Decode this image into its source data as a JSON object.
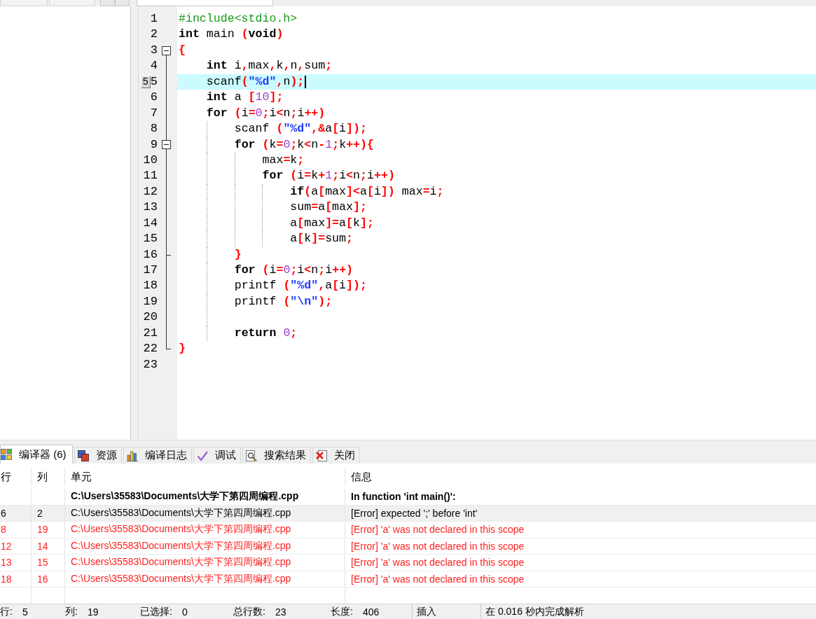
{
  "editor": {
    "lines": [
      {
        "number": "1",
        "tokens": [
          {
            "kind": "preprocessor",
            "text": "#include<stdio.h>"
          }
        ]
      },
      {
        "number": "2",
        "tokens": [
          {
            "kind": "keyword",
            "text": "int"
          },
          {
            "kind": "identifier",
            "text": " main "
          },
          {
            "kind": "symbol",
            "text": "("
          },
          {
            "kind": "keyword",
            "text": "void"
          },
          {
            "kind": "symbol",
            "text": ")"
          }
        ]
      },
      {
        "number": "3",
        "fold": {
          "kind": "start",
          "expanded": true
        },
        "tokens": [
          {
            "kind": "symbol",
            "text": "{"
          }
        ]
      },
      {
        "number": "4",
        "tokens": [
          {
            "kind": "keyword",
            "text": "    int"
          },
          {
            "kind": "identifier",
            "text": " i"
          },
          {
            "kind": "symbol",
            "text": ","
          },
          {
            "kind": "identifier",
            "text": "max"
          },
          {
            "kind": "symbol",
            "text": ","
          },
          {
            "kind": "identifier",
            "text": "k"
          },
          {
            "kind": "symbol",
            "text": ","
          },
          {
            "kind": "identifier",
            "text": "n"
          },
          {
            "kind": "symbol",
            "text": ","
          },
          {
            "kind": "identifier",
            "text": "sum"
          },
          {
            "kind": "symbol",
            "text": ";"
          }
        ]
      },
      {
        "number": "5",
        "marker": "5",
        "current": true,
        "tokens": [
          {
            "kind": "identifier",
            "text": "    scanf"
          },
          {
            "kind": "symbol",
            "text": "("
          },
          {
            "kind": "string",
            "text": "\"%d\""
          },
          {
            "kind": "symbol",
            "text": ","
          },
          {
            "kind": "identifier",
            "text": "n"
          },
          {
            "kind": "symbol",
            "text": ");"
          }
        ]
      },
      {
        "number": "6",
        "tokens": [
          {
            "kind": "keyword",
            "text": "    int"
          },
          {
            "kind": "identifier",
            "text": " a "
          },
          {
            "kind": "symbol",
            "text": "["
          },
          {
            "kind": "number",
            "text": "10"
          },
          {
            "kind": "symbol",
            "text": "];"
          }
        ]
      },
      {
        "number": "7",
        "tokens": [
          {
            "kind": "keyword",
            "text": "    for "
          },
          {
            "kind": "symbol",
            "text": "("
          },
          {
            "kind": "identifier",
            "text": "i"
          },
          {
            "kind": "symbol",
            "text": "="
          },
          {
            "kind": "number",
            "text": "0"
          },
          {
            "kind": "symbol",
            "text": ";"
          },
          {
            "kind": "identifier",
            "text": "i"
          },
          {
            "kind": "symbol",
            "text": "<"
          },
          {
            "kind": "identifier",
            "text": "n"
          },
          {
            "kind": "symbol",
            "text": ";"
          },
          {
            "kind": "identifier",
            "text": "i"
          },
          {
            "kind": "symbol",
            "text": "++)"
          }
        ]
      },
      {
        "number": "8",
        "tokens": [
          {
            "kind": "identifier",
            "text": "        scanf "
          },
          {
            "kind": "symbol",
            "text": "("
          },
          {
            "kind": "string",
            "text": "\"%d\""
          },
          {
            "kind": "symbol",
            "text": ",&"
          },
          {
            "kind": "identifier",
            "text": "a"
          },
          {
            "kind": "symbol",
            "text": "["
          },
          {
            "kind": "identifier",
            "text": "i"
          },
          {
            "kind": "symbol",
            "text": "]);"
          }
        ]
      },
      {
        "number": "9",
        "fold": {
          "kind": "start",
          "expanded": true
        },
        "tokens": [
          {
            "kind": "keyword",
            "text": "        for "
          },
          {
            "kind": "symbol",
            "text": "("
          },
          {
            "kind": "identifier",
            "text": "k"
          },
          {
            "kind": "symbol",
            "text": "="
          },
          {
            "kind": "number",
            "text": "0"
          },
          {
            "kind": "symbol",
            "text": ";"
          },
          {
            "kind": "identifier",
            "text": "k"
          },
          {
            "kind": "symbol",
            "text": "<"
          },
          {
            "kind": "identifier",
            "text": "n"
          },
          {
            "kind": "symbol",
            "text": "-"
          },
          {
            "kind": "number",
            "text": "1"
          },
          {
            "kind": "symbol",
            "text": ";"
          },
          {
            "kind": "identifier",
            "text": "k"
          },
          {
            "kind": "symbol",
            "text": "++){"
          }
        ]
      },
      {
        "number": "10",
        "tokens": [
          {
            "kind": "identifier",
            "text": "            max"
          },
          {
            "kind": "symbol",
            "text": "="
          },
          {
            "kind": "identifier",
            "text": "k"
          },
          {
            "kind": "symbol",
            "text": ";"
          }
        ]
      },
      {
        "number": "11",
        "tokens": [
          {
            "kind": "keyword",
            "text": "            for "
          },
          {
            "kind": "symbol",
            "text": "("
          },
          {
            "kind": "identifier",
            "text": "i"
          },
          {
            "kind": "symbol",
            "text": "="
          },
          {
            "kind": "identifier",
            "text": "k"
          },
          {
            "kind": "symbol",
            "text": "+"
          },
          {
            "kind": "number",
            "text": "1"
          },
          {
            "kind": "symbol",
            "text": ";"
          },
          {
            "kind": "identifier",
            "text": "i"
          },
          {
            "kind": "symbol",
            "text": "<"
          },
          {
            "kind": "identifier",
            "text": "n"
          },
          {
            "kind": "symbol",
            "text": ";"
          },
          {
            "kind": "identifier",
            "text": "i"
          },
          {
            "kind": "symbol",
            "text": "++)"
          }
        ]
      },
      {
        "number": "12",
        "tokens": [
          {
            "kind": "keyword",
            "text": "                if"
          },
          {
            "kind": "symbol",
            "text": "("
          },
          {
            "kind": "identifier",
            "text": "a"
          },
          {
            "kind": "symbol",
            "text": "["
          },
          {
            "kind": "identifier",
            "text": "max"
          },
          {
            "kind": "symbol",
            "text": "]<"
          },
          {
            "kind": "identifier",
            "text": "a"
          },
          {
            "kind": "symbol",
            "text": "["
          },
          {
            "kind": "identifier",
            "text": "i"
          },
          {
            "kind": "symbol",
            "text": "])"
          },
          {
            "kind": "identifier",
            "text": " max"
          },
          {
            "kind": "symbol",
            "text": "="
          },
          {
            "kind": "identifier",
            "text": "i"
          },
          {
            "kind": "symbol",
            "text": ";"
          }
        ]
      },
      {
        "number": "13",
        "tokens": [
          {
            "kind": "identifier",
            "text": "                sum"
          },
          {
            "kind": "symbol",
            "text": "="
          },
          {
            "kind": "identifier",
            "text": "a"
          },
          {
            "kind": "symbol",
            "text": "["
          },
          {
            "kind": "identifier",
            "text": "max"
          },
          {
            "kind": "symbol",
            "text": "];"
          }
        ]
      },
      {
        "number": "14",
        "tokens": [
          {
            "kind": "identifier",
            "text": "                a"
          },
          {
            "kind": "symbol",
            "text": "["
          },
          {
            "kind": "identifier",
            "text": "max"
          },
          {
            "kind": "symbol",
            "text": "]="
          },
          {
            "kind": "identifier",
            "text": "a"
          },
          {
            "kind": "symbol",
            "text": "["
          },
          {
            "kind": "identifier",
            "text": "k"
          },
          {
            "kind": "symbol",
            "text": "];"
          }
        ]
      },
      {
        "number": "15",
        "tokens": [
          {
            "kind": "identifier",
            "text": "                a"
          },
          {
            "kind": "symbol",
            "text": "["
          },
          {
            "kind": "identifier",
            "text": "k"
          },
          {
            "kind": "symbol",
            "text": "]="
          },
          {
            "kind": "identifier",
            "text": "sum"
          },
          {
            "kind": "symbol",
            "text": ";"
          }
        ]
      },
      {
        "number": "16",
        "fold": {
          "kind": "end"
        },
        "tokens": [
          {
            "kind": "symbol",
            "text": "        }"
          }
        ]
      },
      {
        "number": "17",
        "tokens": [
          {
            "kind": "keyword",
            "text": "        for "
          },
          {
            "kind": "symbol",
            "text": "("
          },
          {
            "kind": "identifier",
            "text": "i"
          },
          {
            "kind": "symbol",
            "text": "="
          },
          {
            "kind": "number",
            "text": "0"
          },
          {
            "kind": "symbol",
            "text": ";"
          },
          {
            "kind": "identifier",
            "text": "i"
          },
          {
            "kind": "symbol",
            "text": "<"
          },
          {
            "kind": "identifier",
            "text": "n"
          },
          {
            "kind": "symbol",
            "text": ";"
          },
          {
            "kind": "identifier",
            "text": "i"
          },
          {
            "kind": "symbol",
            "text": "++)"
          }
        ]
      },
      {
        "number": "18",
        "tokens": [
          {
            "kind": "identifier",
            "text": "        printf "
          },
          {
            "kind": "symbol",
            "text": "("
          },
          {
            "kind": "string",
            "text": "\"%d\""
          },
          {
            "kind": "symbol",
            "text": ","
          },
          {
            "kind": "identifier",
            "text": "a"
          },
          {
            "kind": "symbol",
            "text": "["
          },
          {
            "kind": "identifier",
            "text": "i"
          },
          {
            "kind": "symbol",
            "text": "]);"
          }
        ]
      },
      {
        "number": "19",
        "tokens": [
          {
            "kind": "identifier",
            "text": "        printf "
          },
          {
            "kind": "symbol",
            "text": "("
          },
          {
            "kind": "string",
            "text": "\"\\n\""
          },
          {
            "kind": "symbol",
            "text": ");"
          }
        ]
      },
      {
        "number": "20"
      },
      {
        "number": "21",
        "tokens": [
          {
            "kind": "keyword",
            "text": "        return "
          },
          {
            "kind": "number",
            "text": "0"
          },
          {
            "kind": "symbol",
            "text": ";"
          }
        ]
      },
      {
        "number": "22",
        "fold": {
          "kind": "end"
        },
        "tokens": [
          {
            "kind": "symbol",
            "text": "}"
          }
        ]
      },
      {
        "number": "23"
      }
    ]
  },
  "output_tabs": [
    {
      "kind": "compiler",
      "label": "编译器 (6)",
      "selected": true
    },
    {
      "kind": "resources",
      "label": "资源",
      "selected": false
    },
    {
      "kind": "compile_log",
      "label": "编译日志",
      "selected": false
    },
    {
      "kind": "debug",
      "label": "调试",
      "selected": false
    },
    {
      "kind": "search_results",
      "label": "搜索结果",
      "selected": false
    },
    {
      "kind": "close",
      "label": "关闭",
      "selected": false
    }
  ],
  "messages": {
    "columns": [
      "行",
      "列",
      "单元",
      "信息"
    ],
    "rows": [
      {
        "kind": "note",
        "unit": "C:\\Users\\35583\\Documents\\大学下第四周编程.cpp",
        "message": "In function 'int main()':",
        "selected": false
      },
      {
        "kind": "error",
        "line": "6",
        "column": "2",
        "unit": "C:\\Users\\35583\\Documents\\大学下第四周编程.cpp",
        "message": "[Error] expected ';' before 'int'",
        "selected": true
      },
      {
        "kind": "error",
        "line": "8",
        "column": "19",
        "unit": "C:\\Users\\35583\\Documents\\大学下第四周编程.cpp",
        "message": "[Error] 'a' was not declared in this scope",
        "selected": false
      },
      {
        "kind": "error",
        "line": "12",
        "column": "14",
        "unit": "C:\\Users\\35583\\Documents\\大学下第四周编程.cpp",
        "message": "[Error] 'a' was not declared in this scope",
        "selected": false
      },
      {
        "kind": "error",
        "line": "13",
        "column": "15",
        "unit": "C:\\Users\\35583\\Documents\\大学下第四周编程.cpp",
        "message": "[Error] 'a' was not declared in this scope",
        "selected": false
      },
      {
        "kind": "error",
        "line": "18",
        "column": "16",
        "unit": "C:\\Users\\35583\\Documents\\大学下第四周编程.cpp",
        "message": "[Error] 'a' was not declared in this scope",
        "selected": false
      }
    ]
  },
  "status_bar": {
    "fields": [
      {
        "label": "行:",
        "value": "5"
      },
      {
        "label": "列:",
        "value": "19"
      },
      {
        "label": "已选择:",
        "value": "0"
      },
      {
        "label": "总行数:",
        "value": "23"
      },
      {
        "label": "长度:",
        "value": "406"
      }
    ],
    "mode": "插入",
    "message": "在 0.016 秒内完成解析"
  }
}
